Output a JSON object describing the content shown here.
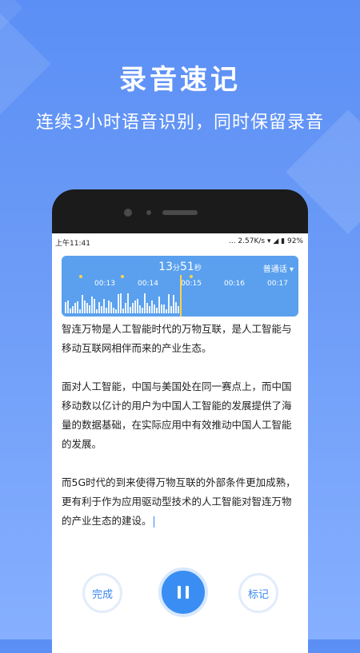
{
  "promo": {
    "title": "录音速记",
    "subtitle": "连续3小时语音识别，同时保留录音"
  },
  "status_bar": {
    "time": "上午11:41",
    "network": "... 2.57K/s",
    "battery": "92%"
  },
  "recorder": {
    "elapsed_min": "13",
    "min_unit": "分",
    "elapsed_sec": "51",
    "sec_unit": "秒",
    "mode_label": "普通话 ▾",
    "timeline": [
      "00:13",
      "00:14",
      "00:15",
      "00:16",
      "00:17"
    ]
  },
  "transcript": [
    "智连万物是人工智能时代的万物互联，是人工智能与移动互联网相伴而来的产业生态。",
    "面对人工智能，中国与美国处在同一赛点上，而中国移动数以亿计的用户为中国人工智能的发展提供了海量的数据基础，在实际应用中有效推动中国人工智能的发展。",
    "而5G时代的到来使得万物互联的外部条件更加成熟，更有利于作为应用驱动型技术的人工智能对智连万物的产业生态的建设。"
  ],
  "controls": {
    "done_label": "完成",
    "mark_label": "标记",
    "pause_icon": "pause-icon"
  },
  "colors": {
    "background": "#5b8ff5",
    "accent": "#3a8ef3",
    "waveform": "#5aa0ee",
    "marker": "#ffd24a"
  }
}
